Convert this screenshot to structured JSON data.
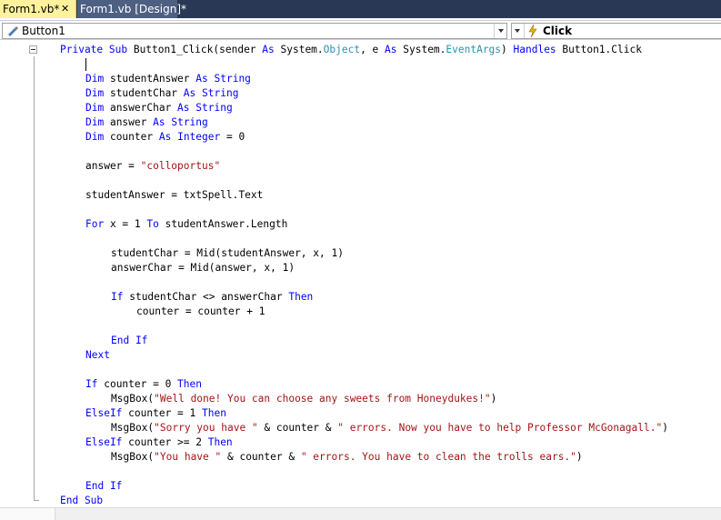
{
  "tabs": [
    {
      "label": "Form1.vb*",
      "close": "✕"
    },
    {
      "label": "Form1.vb [Design]*"
    }
  ],
  "navbar": {
    "object_combo": "Button1",
    "event_combo": "Click"
  },
  "code": [
    [
      {
        "t": "Private Sub ",
        "c": "kw"
      },
      {
        "t": "Button1_Click(sender "
      },
      {
        "t": "As",
        "c": "kw"
      },
      {
        "t": " System."
      },
      {
        "t": "Object",
        "c": "ty"
      },
      {
        "t": ", e "
      },
      {
        "t": "As",
        "c": "kw"
      },
      {
        "t": " System."
      },
      {
        "t": "EventArgs",
        "c": "ty"
      },
      {
        "t": ") "
      },
      {
        "t": "Handles",
        "c": "kw"
      },
      {
        "t": " Button1.Click"
      }
    ],
    [],
    [
      {
        "t": "Dim",
        "c": "kw"
      },
      {
        "t": " studentAnswer "
      },
      {
        "t": "As",
        "c": "kw"
      },
      {
        "t": " "
      },
      {
        "t": "String",
        "c": "kw"
      }
    ],
    [
      {
        "t": "Dim",
        "c": "kw"
      },
      {
        "t": " studentChar "
      },
      {
        "t": "As",
        "c": "kw"
      },
      {
        "t": " "
      },
      {
        "t": "String",
        "c": "kw"
      }
    ],
    [
      {
        "t": "Dim",
        "c": "kw"
      },
      {
        "t": " answerChar "
      },
      {
        "t": "As",
        "c": "kw"
      },
      {
        "t": " "
      },
      {
        "t": "String",
        "c": "kw"
      }
    ],
    [
      {
        "t": "Dim",
        "c": "kw"
      },
      {
        "t": " answer "
      },
      {
        "t": "As",
        "c": "kw"
      },
      {
        "t": " "
      },
      {
        "t": "String",
        "c": "kw"
      }
    ],
    [
      {
        "t": "Dim",
        "c": "kw"
      },
      {
        "t": " counter "
      },
      {
        "t": "As",
        "c": "kw"
      },
      {
        "t": " "
      },
      {
        "t": "Integer",
        "c": "kw"
      },
      {
        "t": " = 0"
      }
    ],
    [],
    [
      {
        "t": "answer = "
      },
      {
        "t": "\"colloportus\"",
        "c": "st"
      }
    ],
    [],
    [
      {
        "t": "studentAnswer = txtSpell.Text"
      }
    ],
    [],
    [
      {
        "t": "For",
        "c": "kw"
      },
      {
        "t": " x = 1 "
      },
      {
        "t": "To",
        "c": "kw"
      },
      {
        "t": " studentAnswer.Length"
      }
    ],
    [],
    [
      {
        "t": "studentChar = Mid(studentAnswer, x, 1)"
      }
    ],
    [
      {
        "t": "answerChar = Mid(answer, x, 1)"
      }
    ],
    [],
    [
      {
        "t": "If",
        "c": "kw"
      },
      {
        "t": " studentChar <> answerChar "
      },
      {
        "t": "Then",
        "c": "kw"
      }
    ],
    [
      {
        "t": "counter = counter + 1"
      }
    ],
    [],
    [
      {
        "t": "End If",
        "c": "kw"
      }
    ],
    [
      {
        "t": "Next",
        "c": "kw"
      }
    ],
    [],
    [
      {
        "t": "If",
        "c": "kw"
      },
      {
        "t": " counter = 0 "
      },
      {
        "t": "Then",
        "c": "kw"
      }
    ],
    [
      {
        "t": "MsgBox("
      },
      {
        "t": "\"Well done! You can choose any sweets from Honeydukes!\"",
        "c": "st"
      },
      {
        "t": ")"
      }
    ],
    [
      {
        "t": "ElseIf",
        "c": "kw"
      },
      {
        "t": " counter = 1 "
      },
      {
        "t": "Then",
        "c": "kw"
      }
    ],
    [
      {
        "t": "MsgBox("
      },
      {
        "t": "\"Sorry you have \"",
        "c": "st"
      },
      {
        "t": " & counter & "
      },
      {
        "t": "\" errors. Now you have to help Professor McGonagall.\"",
        "c": "st"
      },
      {
        "t": ")"
      }
    ],
    [
      {
        "t": "ElseIf",
        "c": "kw"
      },
      {
        "t": " counter >= 2 "
      },
      {
        "t": "Then",
        "c": "kw"
      }
    ],
    [
      {
        "t": "MsgBox("
      },
      {
        "t": "\"You have \"",
        "c": "st"
      },
      {
        "t": " & counter & "
      },
      {
        "t": "\" errors. You have to clean the trolls ears.\"",
        "c": "st"
      },
      {
        "t": ")"
      }
    ],
    [],
    [
      {
        "t": "End If",
        "c": "kw"
      }
    ],
    [
      {
        "t": "End Sub",
        "c": "kw"
      }
    ]
  ]
}
